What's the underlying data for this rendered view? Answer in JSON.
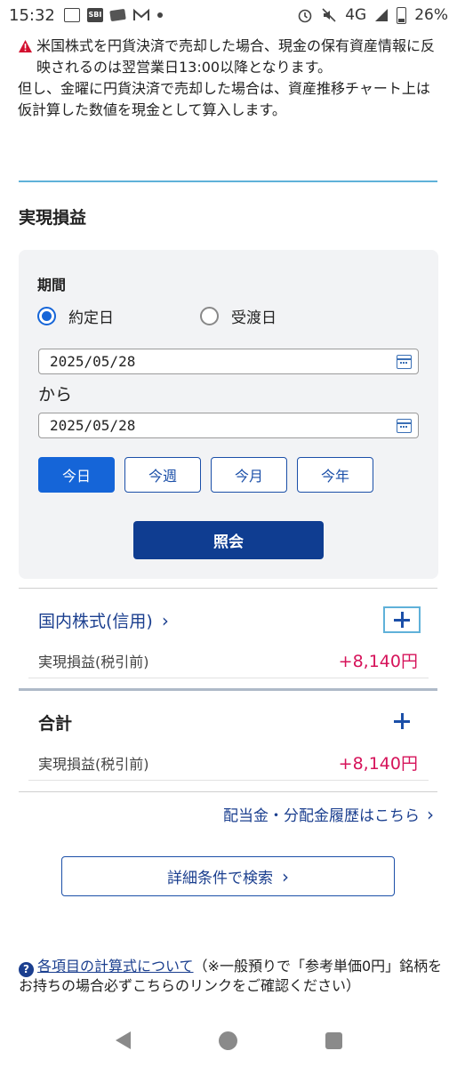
{
  "status_bar": {
    "time": "15:32",
    "network": "4G",
    "battery": "26%"
  },
  "notice": {
    "line1": "米国株式を円貨決済で売却した場合、現金の保有資産情報に反映されるのは翌営業日13:00以降となります。",
    "line2": "但し、金曜に円貨決済で売却した場合は、資産推移チャート上は仮計算した数値を現金として算入します。"
  },
  "section_title": "実現損益",
  "period": {
    "label": "期間",
    "radio_contract": "約定日",
    "radio_delivery": "受渡日",
    "from_date": "2025/05/28",
    "separator": "から",
    "to_date": "2025/05/28",
    "quick": [
      "今日",
      "今週",
      "今月",
      "今年"
    ],
    "search_label": "照会"
  },
  "results": {
    "domestic": {
      "title": "国内株式(信用)",
      "row_label": "実現損益(税引前)",
      "value": "+8,140円"
    },
    "total": {
      "title": "合計",
      "row_label": "実現損益(税引前)",
      "value": "+8,140円"
    }
  },
  "links": {
    "dividend": "配当金・分配金履歴はこちら",
    "detail_search": "詳細条件で検索"
  },
  "help": {
    "link_text": "各項目の計算式について",
    "note": "（※一般預りで「参考単価0円」銘柄をお持ちの場合必ずこちらのリンクをご確認ください）"
  },
  "colors": {
    "accent": "#1565d8",
    "navy": "#0f3d91",
    "profit": "#d6135a"
  }
}
